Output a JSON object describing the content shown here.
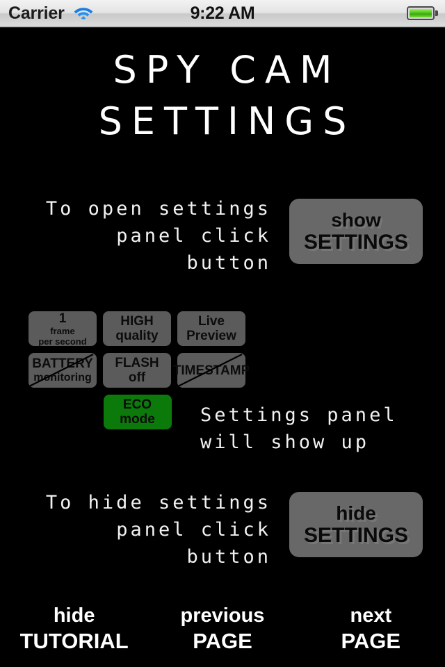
{
  "status_bar": {
    "carrier": "Carrier",
    "wifi_icon": "wifi-icon",
    "time": "9:22 AM",
    "battery_icon": "battery-full-icon"
  },
  "title": {
    "line1": "SPY CAM",
    "line2": "SETTINGS"
  },
  "open_instructions": {
    "line1": "To open settings",
    "line2": "panel click",
    "line3": "button"
  },
  "show_settings_button": {
    "line1": "show",
    "line2": "SETTINGS"
  },
  "hide_instructions": {
    "line1": "To hide settings",
    "line2": "panel click",
    "line3": "button"
  },
  "hide_settings_button": {
    "line1": "hide",
    "line2": "SETTINGS"
  },
  "settings_panel": {
    "buttons": [
      {
        "name": "frame-rate",
        "line1": "1",
        "line2": "frame",
        "line3": "per second",
        "state": "enabled",
        "color": "#5b5b5b"
      },
      {
        "name": "quality",
        "line1": "HIGH",
        "line2": "quality",
        "state": "enabled",
        "color": "#5b5b5b"
      },
      {
        "name": "live-preview",
        "line1": "Live",
        "line2": "Preview",
        "state": "enabled",
        "color": "#5b5b5b"
      },
      {
        "name": "battery-monitoring",
        "line1": "BATTERY",
        "line2": "monitoring",
        "state": "disabled",
        "color": "#5b5b5b"
      },
      {
        "name": "flash",
        "line1": "FLASH",
        "line2": "off",
        "state": "enabled",
        "color": "#5b5b5b"
      },
      {
        "name": "timestamp",
        "line1": "TIMESTAMP",
        "state": "disabled",
        "color": "#5b5b5b"
      },
      {
        "name": "eco-mode",
        "line1": "ECO",
        "line2": "mode",
        "state": "active",
        "color": "#0b7a0b"
      }
    ]
  },
  "panel_note": {
    "line1": "Settings panel",
    "line2": "will show up"
  },
  "bottom_nav": [
    {
      "name": "hide-tutorial",
      "line1": "hide",
      "line2": "TUTORIAL"
    },
    {
      "name": "previous-page",
      "line1": "previous",
      "line2": "PAGE"
    },
    {
      "name": "next-page",
      "line1": "next",
      "line2": "PAGE"
    }
  ],
  "colors": {
    "background": "#000000",
    "button_gray": "#5b5b5b",
    "big_button_gray": "#686868",
    "eco_green": "#0b7a0b",
    "text_white": "#ffffff"
  }
}
